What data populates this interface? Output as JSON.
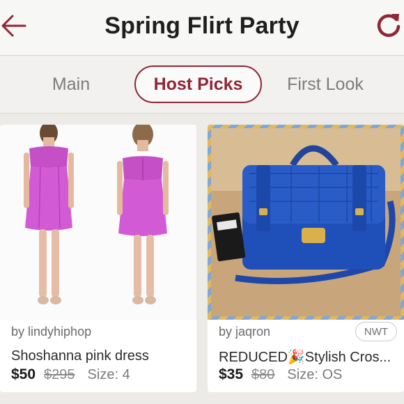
{
  "header": {
    "title": "Spring Flirt Party",
    "back_icon": "arrow-left-icon",
    "refresh_icon": "refresh-icon",
    "accent": "#8f2636"
  },
  "tabs": [
    {
      "label": "Main"
    },
    {
      "label": "Host Picks",
      "active": true
    },
    {
      "label": "First Look"
    }
  ],
  "listings": [
    {
      "seller": "by lindyhiphop",
      "title": "Shoshanna pink dress",
      "price": "$50",
      "original_price": "$295",
      "size": "Size: 4"
    },
    {
      "seller": "by jaqron",
      "badge": "NWT",
      "title": "REDUCED🎉Stylish Cros...",
      "price": "$35",
      "original_price": "$80",
      "size": "Size: OS"
    }
  ]
}
